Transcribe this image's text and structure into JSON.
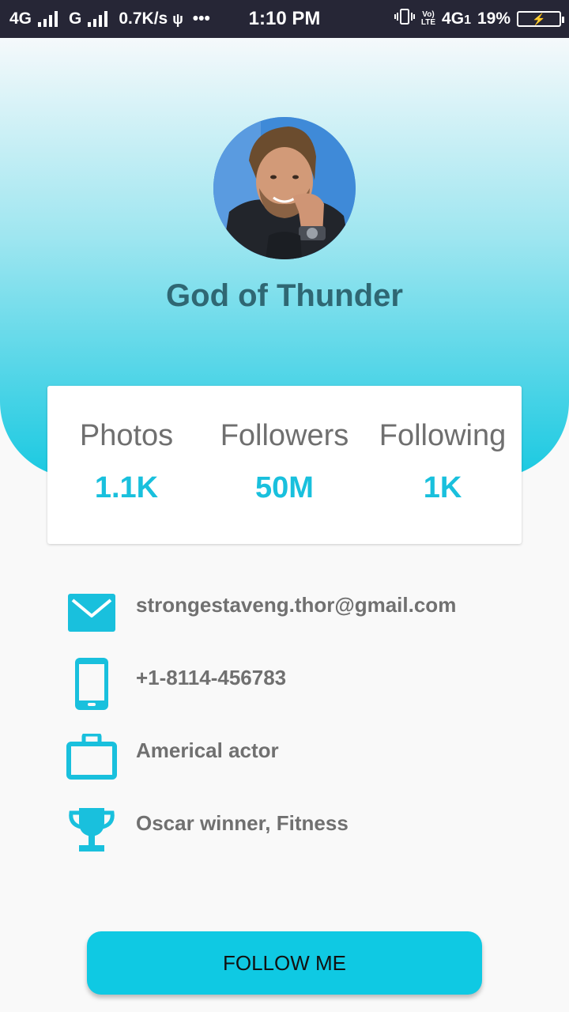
{
  "status_bar": {
    "net1": "4G",
    "net2": "G",
    "speed": "0.7K/s",
    "dots": "•••",
    "time": "1:10 PM",
    "volte_top": "Vo)",
    "volte_bottom": "LTE",
    "net3": "4G",
    "net3_sub": "1",
    "battery_percent": "19%"
  },
  "profile": {
    "name": "God of Thunder"
  },
  "stats": [
    {
      "label": "Photos",
      "value": "1.1K"
    },
    {
      "label": "Followers",
      "value": "50M"
    },
    {
      "label": "Following",
      "value": "1K"
    }
  ],
  "info": {
    "email": "strongestaveng.thor@gmail.com",
    "phone": "+1-8114-456783",
    "occupation": "Americal actor",
    "achievements": "Oscar winner, Fitness"
  },
  "follow_button": {
    "label": "FOLLOW ME"
  },
  "colors": {
    "accent": "#19c0dd",
    "button": "#0fc9e3",
    "name_text": "#2f6773",
    "status_bar": "#262636"
  },
  "icons": {
    "email": "envelope-icon",
    "phone": "smartphone-icon",
    "occupation": "briefcase-icon",
    "achievements": "trophy-icon"
  }
}
